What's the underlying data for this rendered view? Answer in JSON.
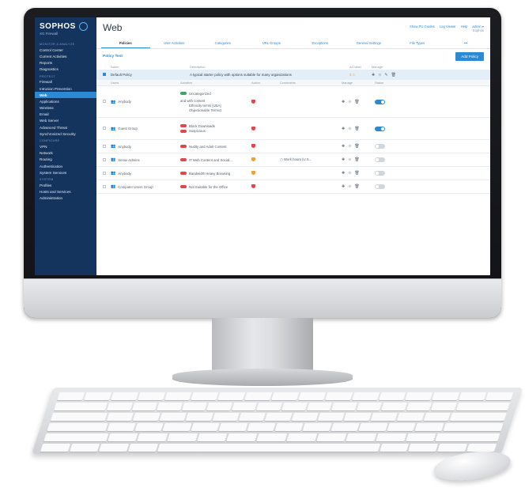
{
  "app": {
    "brand": "SOPHOS",
    "product": "XG Firewall"
  },
  "sidebar": {
    "sections": [
      {
        "title": "MONITOR & ANALYZE",
        "items": [
          "Control Center",
          "Current Activities",
          "Reports",
          "Diagnostics"
        ]
      },
      {
        "title": "PROTECT",
        "items": [
          "Firewall",
          "Intrusion Prevention",
          "Web",
          "Applications",
          "Wireless",
          "Email",
          "Web Server",
          "Advanced Threat",
          "Synchronized Security"
        ]
      },
      {
        "title": "CONFIGURE",
        "items": [
          "VPN",
          "Network",
          "Routing",
          "Authentication",
          "System Services"
        ]
      },
      {
        "title": "SYSTEM",
        "items": [
          "Profiles",
          "Hosts and Services",
          "Administration"
        ]
      }
    ],
    "active_item": "Web"
  },
  "header": {
    "title": "Web",
    "links": [
      "Show PU Guides",
      "Log Viewer",
      "Help",
      "admin ▾"
    ],
    "user_org": "Sophos"
  },
  "tabs": [
    {
      "label": "Policies",
      "active": true
    },
    {
      "label": "User Activities",
      "active": false
    },
    {
      "label": "Categories",
      "active": false
    },
    {
      "label": "URL Groups",
      "active": false
    },
    {
      "label": "Exceptions",
      "active": false
    },
    {
      "label": "General Settings",
      "active": false
    },
    {
      "label": "File Types",
      "active": false
    },
    {
      "label": "•••",
      "active": false
    }
  ],
  "policies": {
    "section_title": "Policy Test",
    "add_button": "Add Policy",
    "outer_columns": {
      "name": "Name",
      "description": "Description",
      "ac": "AC label",
      "manage": "Manage"
    },
    "default_policy": {
      "name": "Default Policy",
      "description": "A typical starter policy with options suitable for many organizations",
      "ac_value": "0 ⚠"
    },
    "inner_columns": {
      "users": "Users",
      "activities": "Activities",
      "action": "Action",
      "constraints": "Constraints",
      "manage": "Manage",
      "status": "Status"
    },
    "rules": [
      {
        "users": "Anybody",
        "activities": [
          {
            "color": "green",
            "label": "Uncategorized"
          }
        ],
        "extra_label": "and with content",
        "extra_lines": [
          "Ethnicity terms [USA]",
          "Objectionable Terms1"
        ],
        "action": "red",
        "constraint": "",
        "status": "on"
      },
      {
        "users": "Guest Group",
        "activities": [
          {
            "color": "red",
            "label": "Block Downloads"
          },
          {
            "color": "red",
            "label": "Suspicious"
          }
        ],
        "action": "red",
        "constraint": "",
        "status": "on"
      },
      {
        "users": "Anybody",
        "activities": [
          {
            "color": "red",
            "label": "Nudity and Adult Content"
          }
        ],
        "action": "red",
        "constraint": "",
        "status": "off"
      },
      {
        "users": "Sense Admins",
        "activities": [
          {
            "color": "red",
            "label": "IT Web Content and Social..."
          }
        ],
        "action": "orange",
        "constraint": "Work hours (U.S...",
        "status": "off"
      },
      {
        "users": "Anybody",
        "activities": [
          {
            "color": "red",
            "label": "Bandwidth Heavy Browsing"
          }
        ],
        "action": "orange",
        "constraint": "",
        "status": "off"
      },
      {
        "users": "Computer Users Group",
        "activities": [
          {
            "color": "red",
            "label": "Not Suitable for the Office"
          }
        ],
        "action": "red",
        "constraint": "",
        "status": "off"
      }
    ]
  },
  "colors": {
    "sidebar_bg": "#14335d",
    "accent": "#2c8ad4",
    "block": "#e0474c",
    "warn": "#f0a030",
    "allow": "#43a16b"
  }
}
